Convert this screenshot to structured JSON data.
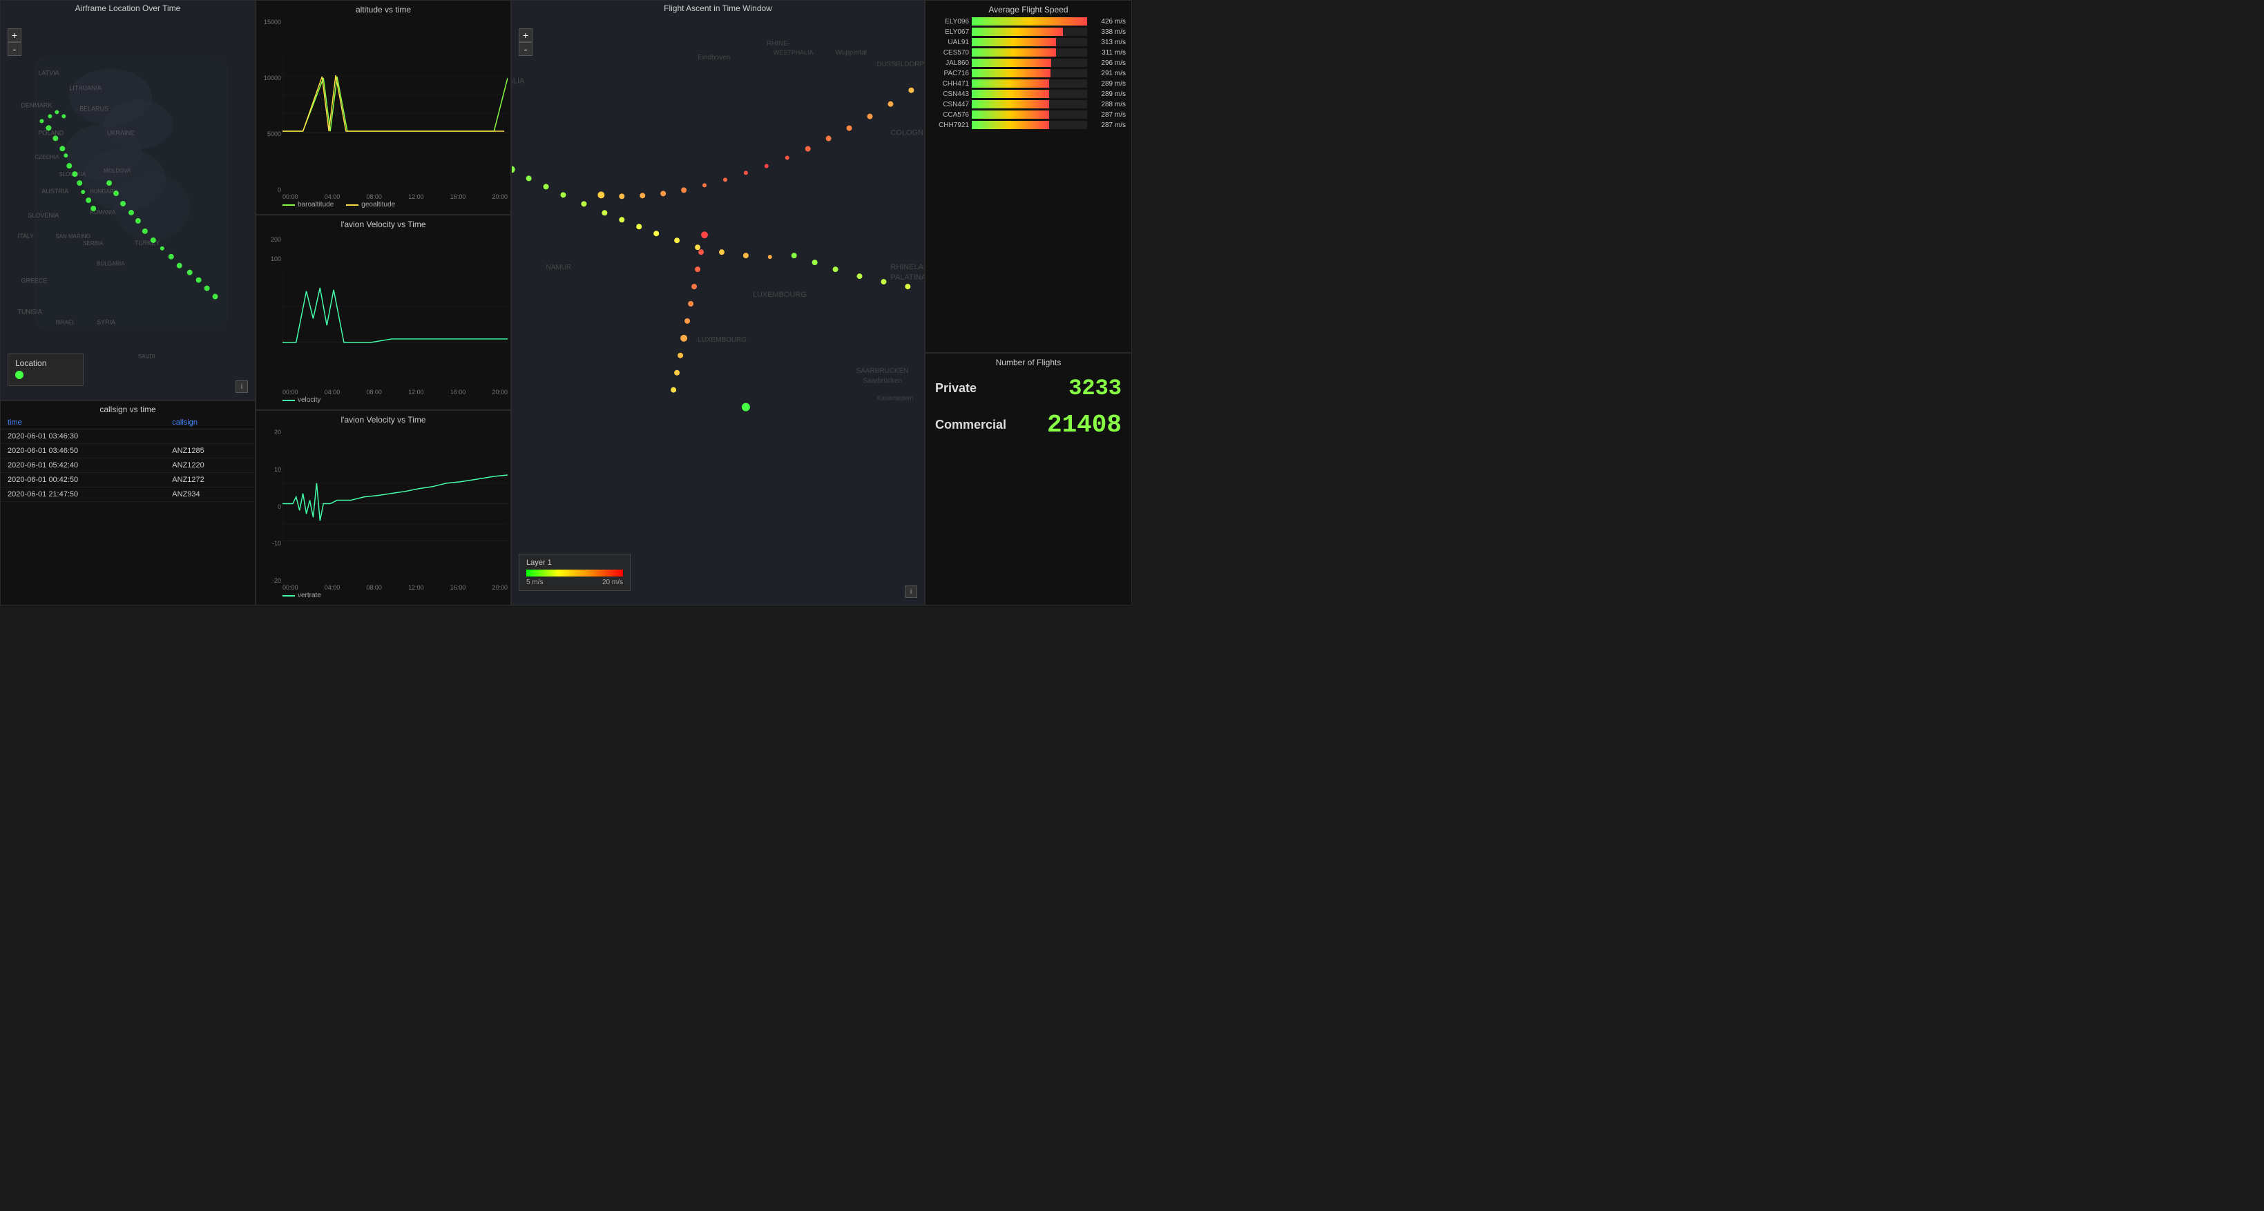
{
  "maps": {
    "left_title": "Airframe Location Over Time",
    "right_title": "Flight Ascent in Time Window"
  },
  "charts": {
    "altitude_title": "altitude vs time",
    "velocity_title": "l'avion Velocity vs Time",
    "vertrate_title": "l'avion Velocity vs Time",
    "xaxis_labels": [
      "00:00",
      "04:00",
      "08:00",
      "12:00",
      "16:00",
      "20:00"
    ],
    "altitude_yaxis": [
      "15000",
      "10000",
      "5000",
      "0"
    ],
    "velocity_yaxis": [
      "200",
      "100"
    ],
    "vertrate_yaxis": [
      "20",
      "10",
      "0",
      "-10",
      "-20"
    ],
    "altitude_legend": [
      {
        "label": "baroaltitude",
        "color": "#88ff44"
      },
      {
        "label": "geoaltitude",
        "color": "#ffdd44"
      }
    ],
    "velocity_legend": [
      {
        "label": "velocity",
        "color": "#44ffaa"
      }
    ],
    "vertrate_legend": [
      {
        "label": "vertrate",
        "color": "#44ffaa"
      }
    ]
  },
  "table": {
    "title": "callsign vs time",
    "col_time": "time",
    "col_callsign": "callsign",
    "rows": [
      {
        "time": "2020-06-01 03:46:30",
        "callsign": ""
      },
      {
        "time": "2020-06-01 03:46:50",
        "callsign": "ANZ1285"
      },
      {
        "time": "2020-06-01 05:42:40",
        "callsign": "ANZ1220"
      },
      {
        "time": "2020-06-01 00:42:50",
        "callsign": "ANZ1272"
      },
      {
        "time": "2020-06-01 21:47:50",
        "callsign": "ANZ934"
      }
    ]
  },
  "bar_chart": {
    "title": "Average Flight Speed",
    "bars": [
      {
        "label": "ELY096",
        "value": "426 m/s",
        "pct": 100
      },
      {
        "label": "ELY067",
        "value": "338 m/s",
        "pct": 79
      },
      {
        "label": "UAL91",
        "value": "313 m/s",
        "pct": 73
      },
      {
        "label": "CES570",
        "value": "311 m/s",
        "pct": 73
      },
      {
        "label": "JAL860",
        "value": "296 m/s",
        "pct": 69
      },
      {
        "label": "PAC716",
        "value": "291 m/s",
        "pct": 68
      },
      {
        "label": "CHH471",
        "value": "289 m/s",
        "pct": 67
      },
      {
        "label": "CSN443",
        "value": "289 m/s",
        "pct": 67
      },
      {
        "label": "CSN447",
        "value": "288 m/s",
        "pct": 67
      },
      {
        "label": "CCA576",
        "value": "287 m/s",
        "pct": 67
      },
      {
        "label": "CHH7921",
        "value": "287 m/s",
        "pct": 67
      }
    ]
  },
  "numbers": {
    "title": "Number of Flights",
    "rows": [
      {
        "type": "Private",
        "value": "3233"
      },
      {
        "type": "Commercial",
        "value": "21408"
      }
    ]
  },
  "location": {
    "label": "Location"
  },
  "layer": {
    "label": "Layer 1",
    "min_label": "5 m/s",
    "max_label": "20 m/s"
  },
  "zoom": {
    "plus": "+",
    "minus": "-"
  }
}
